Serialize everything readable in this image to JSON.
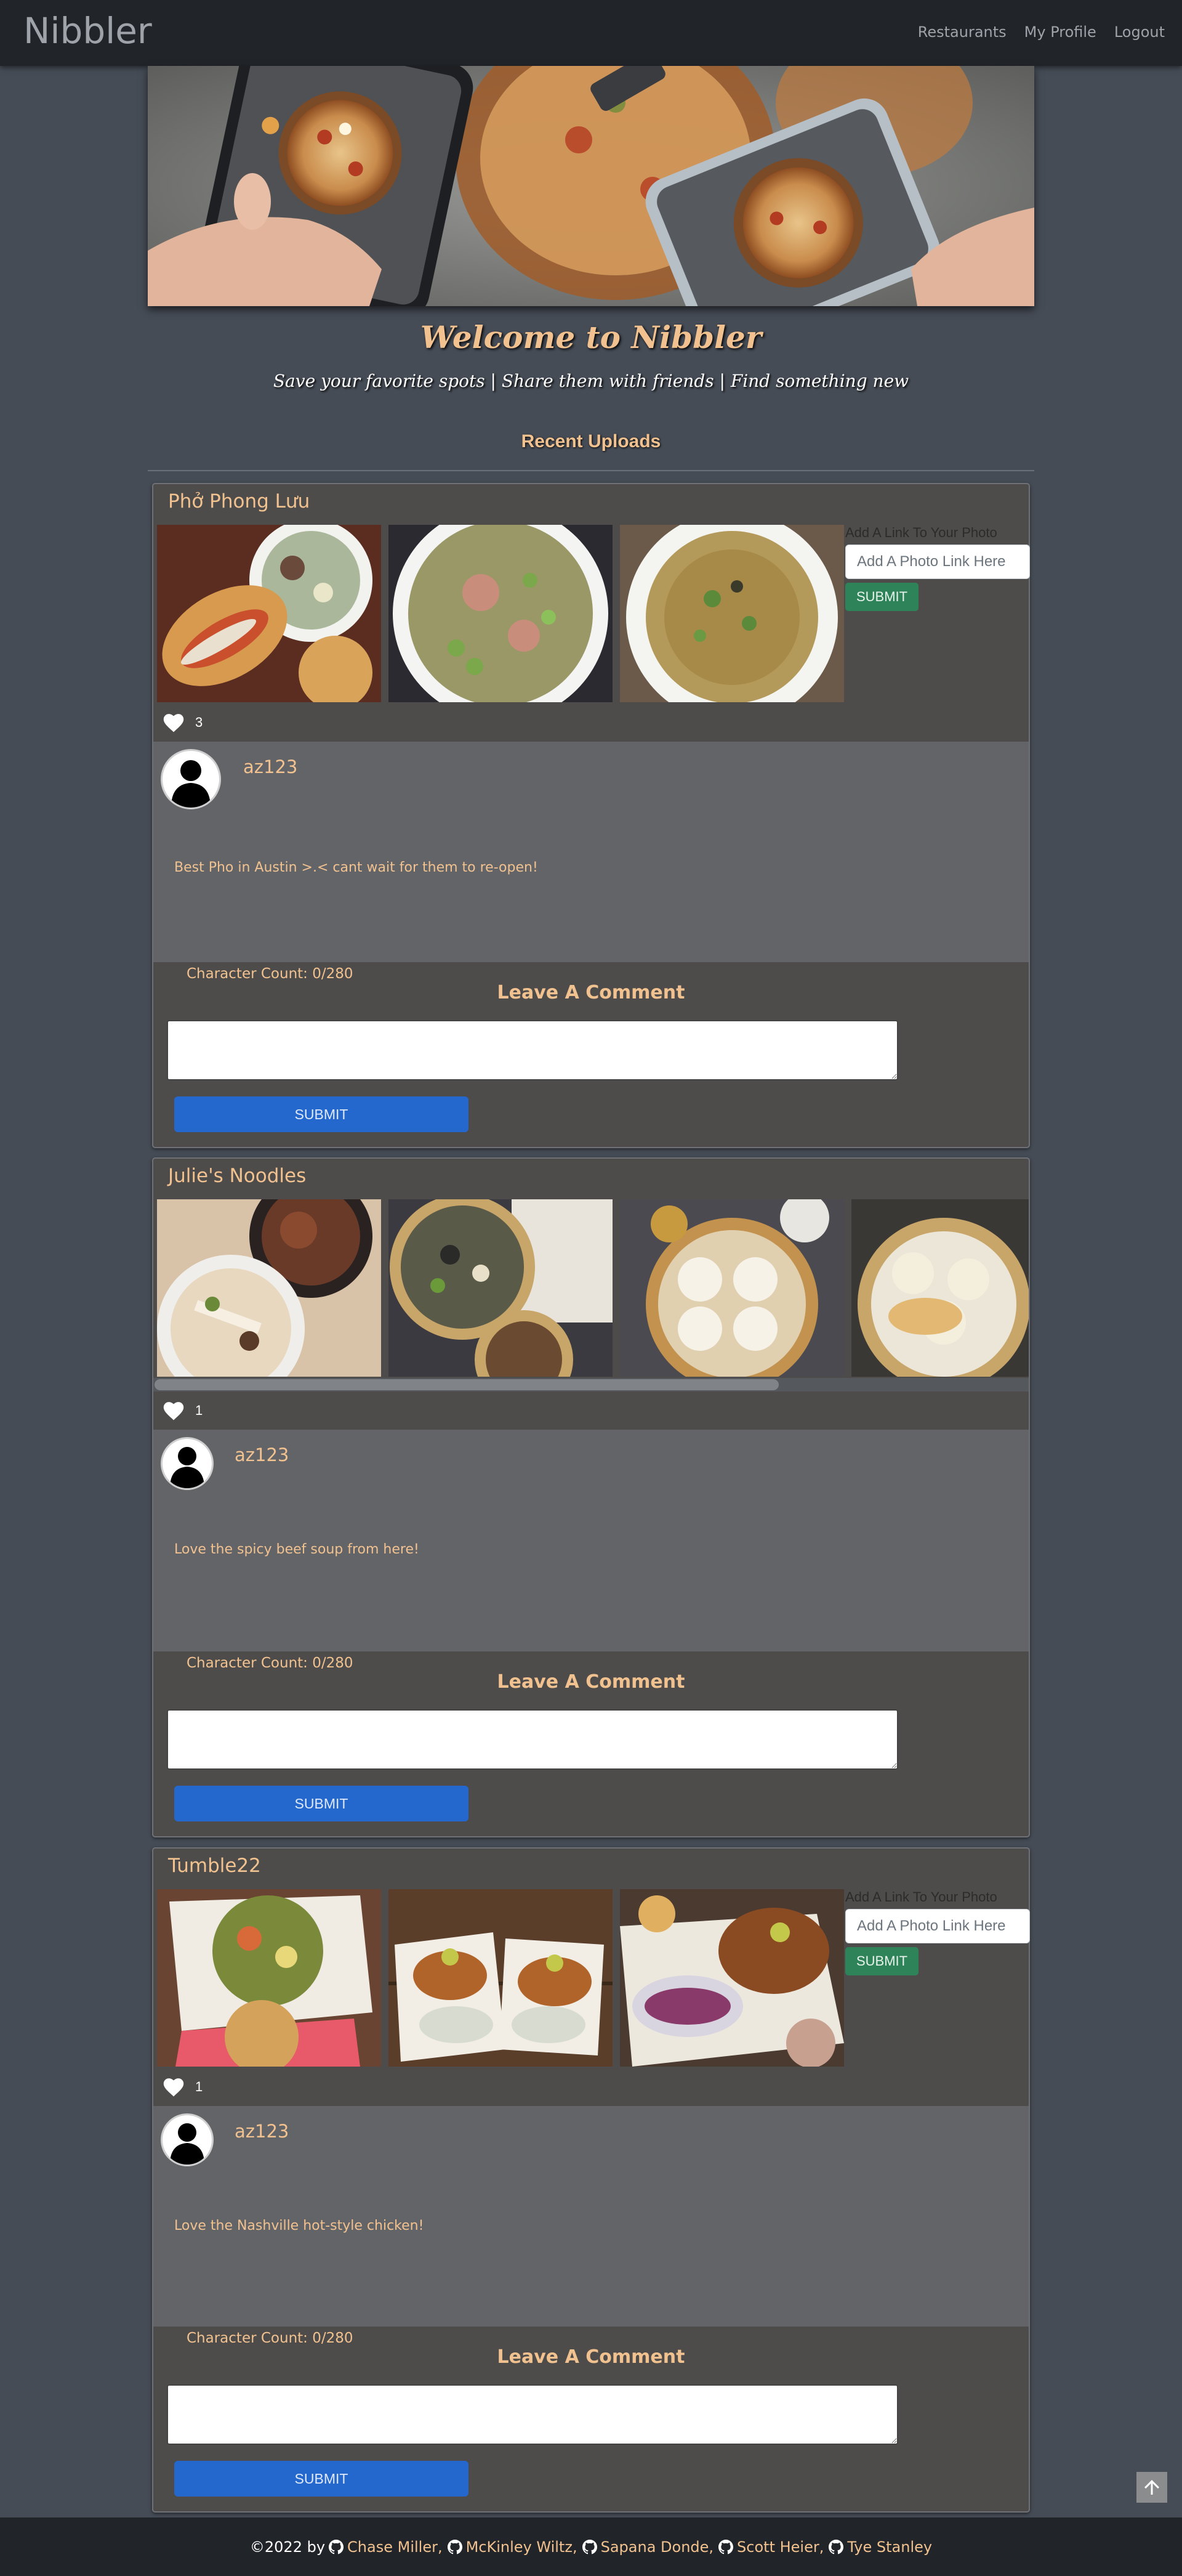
{
  "nav": {
    "brand": "Nibbler",
    "links": [
      "Restaurants",
      "My Profile",
      "Logout"
    ]
  },
  "hero": {
    "title": "Welcome to Nibbler",
    "tagline": "Save your favorite spots | Share them with friends | Find something new"
  },
  "recent_heading": "Recent Uploads",
  "photo_form": {
    "label": "Add A Link To Your Photo",
    "placeholder": "Add A Photo Link Here",
    "submit": "SUBMIT"
  },
  "comment_form": {
    "char_count": "Character Count: 0/280",
    "heading": "Leave A Comment",
    "submit": "SUBMIT"
  },
  "posts": [
    {
      "title": "Phở Phong Lưu",
      "likes": "3",
      "reviewer": "az123",
      "review": "Best Pho in Austin >.< cant wait for them to re-open!"
    },
    {
      "title": "Julie's Noodles",
      "likes": "1",
      "reviewer": "az123",
      "review": "Love the spicy beef soup from here!"
    },
    {
      "title": "Tumble22",
      "likes": "1",
      "reviewer": "az123",
      "review": "Love the Nashville hot-style chicken!"
    }
  ],
  "footer": {
    "copyright": "©2022 by",
    "authors": [
      "Chase Miller",
      "McKinley Wiltz",
      "Sapana Donde",
      "Scott Heier",
      "Tye Stanley"
    ]
  },
  "colors": {
    "accent": "#f1c28f",
    "page_bg": "#464c56",
    "nav_bg": "#212429",
    "card_bg": "#4e4c4b",
    "review_bg": "#636468",
    "comment_submit": "#2467cd",
    "photo_submit": "#2f8358"
  }
}
